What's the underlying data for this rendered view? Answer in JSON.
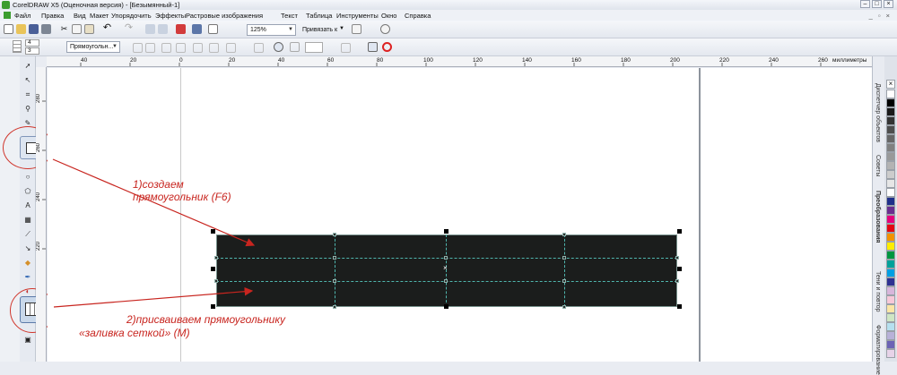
{
  "window": {
    "title": "CorelDRAW X5 (Оценочная версия) - [Безымянный-1]"
  },
  "menu": [
    "Файл",
    "Правка",
    "Вид",
    "Макет",
    "Упорядочить",
    "Эффекты",
    "Растровые изображения",
    "Текст",
    "Таблица",
    "Инструменты",
    "Окно",
    "Справка"
  ],
  "toolbar": {
    "zoom": "125%",
    "snap_label": "Привязать к"
  },
  "propbar": {
    "rows": "4",
    "cols": "3",
    "object_type": "Прямоугольн..."
  },
  "ruler": {
    "h_labels": [
      "40",
      "20",
      "0",
      "20",
      "40",
      "60",
      "80",
      "100",
      "120",
      "140",
      "160",
      "180",
      "200",
      "220",
      "240",
      "260"
    ],
    "units": "миллиметры",
    "v_labels": [
      "280",
      "260",
      "240",
      "220"
    ]
  },
  "dockers": [
    "Диспетчер объектов",
    "Советы",
    "Преобразования",
    "Тени и повтор",
    "Форматирование"
  ],
  "palette": [
    "#ffffff",
    "#000000",
    "#1a1a1a",
    "#333333",
    "#4d4d4d",
    "#666666",
    "#808080",
    "#999999",
    "#b3b3b3",
    "#cccccc",
    "#e6e6e6",
    "#ffffff",
    "#1f2f8a",
    "#6a2d8f",
    "#e4007c",
    "#e30613",
    "#f39200",
    "#ffed00",
    "#009640",
    "#00a19a",
    "#009fe3",
    "#2e3192",
    "#d8b6db",
    "#f7c8d8",
    "#fbe6a6",
    "#cfe6c4",
    "#b6e0ef",
    "#b8b1d8",
    "#6c63b5",
    "#e7d3e8"
  ],
  "annotations": {
    "step1_line1": "1)создаем",
    "step1_line2": "прямоугольник (F6)",
    "step2_line1": "2)присваиваем прямоугольнику",
    "step2_line2": "«заливка сеткой» (M)"
  }
}
